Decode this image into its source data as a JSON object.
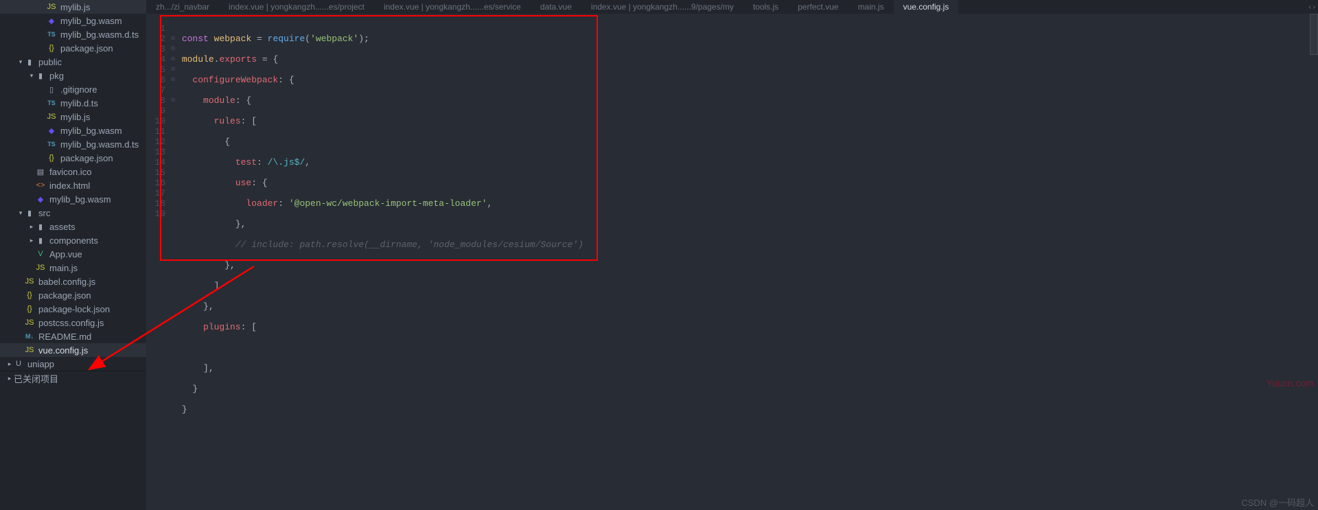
{
  "sidebar": {
    "tree": [
      {
        "indent": 3,
        "chev": "",
        "icon": "js",
        "iconText": "JS",
        "label": "mylib.js"
      },
      {
        "indent": 3,
        "chev": "",
        "icon": "wasm",
        "iconText": "◆",
        "label": "mylib_bg.wasm"
      },
      {
        "indent": 3,
        "chev": "",
        "icon": "ts",
        "iconText": "TS",
        "label": "mylib_bg.wasm.d.ts"
      },
      {
        "indent": 3,
        "chev": "",
        "icon": "braces",
        "iconText": "{}",
        "label": "package.json"
      },
      {
        "indent": 1,
        "chev": "▾",
        "icon": "folder",
        "iconText": "▮",
        "label": "public"
      },
      {
        "indent": 2,
        "chev": "▾",
        "icon": "folder",
        "iconText": "▮",
        "label": "pkg"
      },
      {
        "indent": 3,
        "chev": "",
        "icon": "file",
        "iconText": "▯",
        "label": ".gitignore"
      },
      {
        "indent": 3,
        "chev": "",
        "icon": "ts",
        "iconText": "TS",
        "label": "mylib.d.ts"
      },
      {
        "indent": 3,
        "chev": "",
        "icon": "js",
        "iconText": "JS",
        "label": "mylib.js"
      },
      {
        "indent": 3,
        "chev": "",
        "icon": "wasm",
        "iconText": "◆",
        "label": "mylib_bg.wasm"
      },
      {
        "indent": 3,
        "chev": "",
        "icon": "ts",
        "iconText": "TS",
        "label": "mylib_bg.wasm.d.ts"
      },
      {
        "indent": 3,
        "chev": "",
        "icon": "braces",
        "iconText": "{}",
        "label": "package.json"
      },
      {
        "indent": 2,
        "chev": "",
        "icon": "file",
        "iconText": "▤",
        "label": "favicon.ico"
      },
      {
        "indent": 2,
        "chev": "",
        "icon": "html",
        "iconText": "<>",
        "label": "index.html"
      },
      {
        "indent": 2,
        "chev": "",
        "icon": "wasm",
        "iconText": "◆",
        "label": "mylib_bg.wasm"
      },
      {
        "indent": 1,
        "chev": "▾",
        "icon": "folder",
        "iconText": "▮",
        "label": "src"
      },
      {
        "indent": 2,
        "chev": "▸",
        "icon": "folder",
        "iconText": "▮",
        "label": "assets"
      },
      {
        "indent": 2,
        "chev": "▸",
        "icon": "folder",
        "iconText": "▮",
        "label": "components"
      },
      {
        "indent": 2,
        "chev": "",
        "icon": "vue",
        "iconText": "V",
        "label": "App.vue"
      },
      {
        "indent": 2,
        "chev": "",
        "icon": "js",
        "iconText": "JS",
        "label": "main.js"
      },
      {
        "indent": 1,
        "chev": "",
        "icon": "js",
        "iconText": "JS",
        "label": "babel.config.js"
      },
      {
        "indent": 1,
        "chev": "",
        "icon": "braces",
        "iconText": "{}",
        "label": "package.json"
      },
      {
        "indent": 1,
        "chev": "",
        "icon": "braces",
        "iconText": "{}",
        "label": "package-lock.json"
      },
      {
        "indent": 1,
        "chev": "",
        "icon": "js",
        "iconText": "JS",
        "label": "postcss.config.js"
      },
      {
        "indent": 1,
        "chev": "",
        "icon": "md",
        "iconText": "M↓",
        "label": "README.md"
      },
      {
        "indent": 1,
        "chev": "",
        "icon": "js",
        "iconText": "JS",
        "label": "vue.config.js",
        "selected": true
      },
      {
        "indent": 0,
        "chev": "▸",
        "icon": "folder",
        "iconText": "U",
        "label": "uniapp"
      }
    ],
    "closed_projects_chev": "▸",
    "closed_projects_label": "已关闭项目"
  },
  "tabs": [
    {
      "label": "zh.../zi_navbar"
    },
    {
      "label": "index.vue | yongkangzh......es/project"
    },
    {
      "label": "index.vue | yongkangzh......es/service"
    },
    {
      "label": "data.vue"
    },
    {
      "label": "index.vue | yongkangzh......9/pages/my"
    },
    {
      "label": "tools.js"
    },
    {
      "label": "perfect.vue"
    },
    {
      "label": "main.js"
    },
    {
      "label": "vue.config.js",
      "active": true
    }
  ],
  "tabs_nav": "‹ ›",
  "code": {
    "line_count": 19,
    "fold_markers": {
      "2": "⊟",
      "3": "⊟",
      "4": "⊟",
      "5": "⊟",
      "6": "⊟",
      "8": "⊟"
    },
    "l1_const": "const",
    "l1_webpack": "webpack",
    "l1_eq": " = ",
    "l1_require": "require",
    "l1_paren_open": "(",
    "l1_str": "'webpack'",
    "l1_paren_close": ");",
    "l2_module": "module",
    "l2_dot": ".",
    "l2_exports": "exports",
    "l2_eq": " = {",
    "l3_key": "configureWebpack",
    "l3_colon": ": {",
    "l4_key": "module",
    "l4_colon": ": {",
    "l5_key": "rules",
    "l5_colon": ": [",
    "l6": "{",
    "l7_key": "test",
    "l7_colon": ": ",
    "l7_regex": "/\\.js$/",
    "l7_comma": ",",
    "l8_key": "use",
    "l8_colon": ": {",
    "l9_key": "loader",
    "l9_colon": ": ",
    "l9_str": "'@open-wc/webpack-import-meta-loader'",
    "l9_comma": ",",
    "l10": "},",
    "l11_comment": "// include: path.resolve(__dirname, 'node_modules/cesium/Source')",
    "l12": "},",
    "l13": "]",
    "l14": "},",
    "l15_key": "plugins",
    "l15_colon": ": [",
    "l16": "",
    "l17": "],",
    "l18": "}",
    "l19": "}"
  },
  "watermark_right": "Yuucn.com",
  "watermark_footer": "CSDN @一码超人"
}
